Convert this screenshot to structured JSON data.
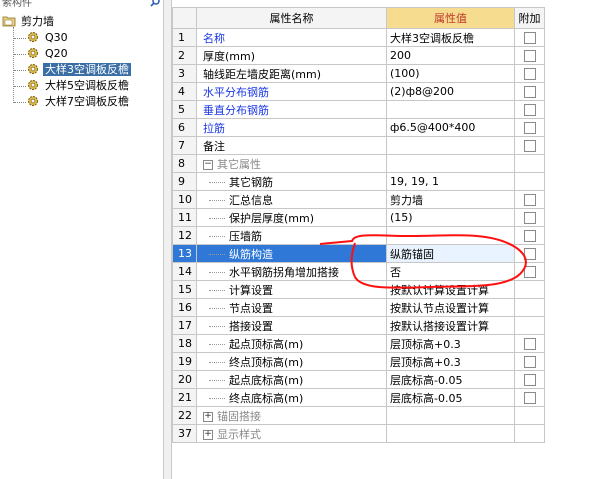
{
  "left_panel": {
    "top_cut_text": "索构件",
    "tree": {
      "root": "剪力墙",
      "items": [
        "Q30",
        "Q20",
        "大样3空调板反檐",
        "大样5空调板反檐",
        "大样7空调板反檐"
      ],
      "selected_index": 2
    }
  },
  "grid": {
    "headers": {
      "name": "属性名称",
      "value": "属性值",
      "extra": "附加"
    },
    "rows": [
      {
        "n": "1",
        "name": "名称",
        "value": "大样3空调板反檐",
        "style": "blue",
        "check": true
      },
      {
        "n": "2",
        "name": "厚度(mm)",
        "value": "200",
        "style": "",
        "check": true
      },
      {
        "n": "3",
        "name": "轴线距左墙皮距离(mm)",
        "value": "(100)",
        "style": "",
        "check": true
      },
      {
        "n": "4",
        "name": "水平分布钢筋",
        "value": "(2)ф8@200",
        "style": "blue",
        "check": true
      },
      {
        "n": "5",
        "name": "垂直分布钢筋",
        "value": "",
        "style": "blue",
        "check": true
      },
      {
        "n": "6",
        "name": "拉筋",
        "value": "ф6.5@400*400",
        "style": "blue",
        "check": true
      },
      {
        "n": "7",
        "name": "备注",
        "value": "",
        "style": "",
        "check": true
      },
      {
        "n": "8",
        "name": "其它属性",
        "value": "",
        "style": "group",
        "check": false
      },
      {
        "n": "9",
        "name": "其它钢筋",
        "value": "19, 19, 1",
        "style": "child",
        "check": false
      },
      {
        "n": "10",
        "name": "汇总信息",
        "value": "剪力墙",
        "style": "child",
        "check": true
      },
      {
        "n": "11",
        "name": "保护层厚度(mm)",
        "value": "(15)",
        "style": "child",
        "check": true
      },
      {
        "n": "12",
        "name": "压墙筋",
        "value": "",
        "style": "child",
        "check": true
      },
      {
        "n": "13",
        "name": "纵筋构造",
        "value": "纵筋锚固",
        "style": "child sel",
        "check": true
      },
      {
        "n": "14",
        "name": "水平钢筋拐角增加搭接",
        "value": "否",
        "style": "child",
        "check": true
      },
      {
        "n": "15",
        "name": "计算设置",
        "value": "按默认计算设置计算",
        "style": "child",
        "check": false
      },
      {
        "n": "16",
        "name": "节点设置",
        "value": "按默认节点设置计算",
        "style": "child",
        "check": false
      },
      {
        "n": "17",
        "name": "搭接设置",
        "value": "按默认搭接设置计算",
        "style": "child",
        "check": false
      },
      {
        "n": "18",
        "name": "起点顶标高(m)",
        "value": "层顶标高+0.3",
        "style": "child",
        "check": true
      },
      {
        "n": "19",
        "name": "终点顶标高(m)",
        "value": "层顶标高+0.3",
        "style": "child",
        "check": true
      },
      {
        "n": "20",
        "name": "起点底标高(m)",
        "value": "层底标高-0.05",
        "style": "child",
        "check": true
      },
      {
        "n": "21",
        "name": "终点底标高(m)",
        "value": "层底标高-0.05",
        "style": "child",
        "check": true
      },
      {
        "n": "22",
        "name": "锚固搭接",
        "value": "",
        "style": "group",
        "check": false
      },
      {
        "n": "37",
        "name": "显示样式",
        "value": "",
        "style": "group",
        "check": false
      }
    ]
  },
  "colors": {
    "selected_row": "#2f78d8",
    "value_header": "#f6dc8e",
    "annotation": "#ff0000",
    "link_blue": "#1a37e6"
  }
}
